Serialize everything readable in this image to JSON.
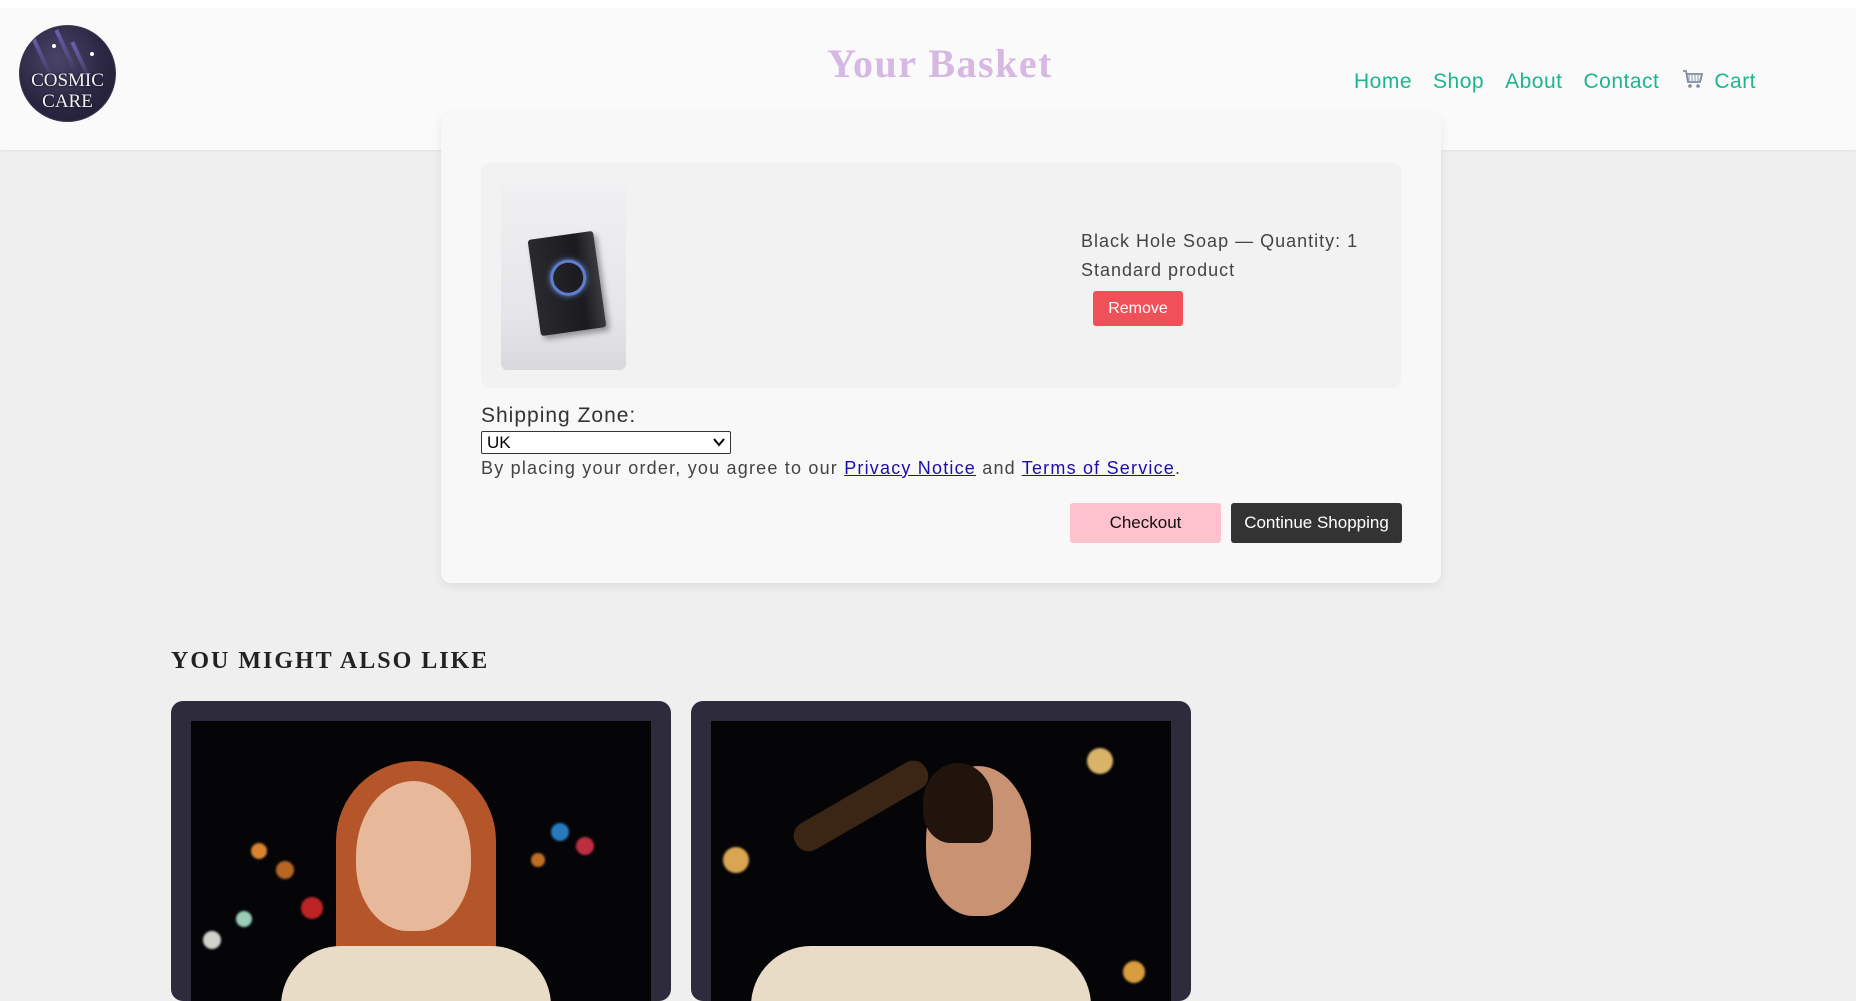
{
  "brand": {
    "logo_line1": "COSMIC",
    "logo_line2": "CARE"
  },
  "page_title": "Your Basket",
  "nav": {
    "items": [
      "Home",
      "Shop",
      "About",
      "Contact"
    ],
    "cart_label": "Cart",
    "cart_icon": "shopping-cart-icon",
    "link_color": "#1db58f"
  },
  "basket": {
    "item": {
      "name_qty": "Black Hole Soap — Quantity: 1",
      "type": "Standard product",
      "remove_label": "Remove",
      "image_icon": "black-hole-soap-image"
    },
    "shipping_label": "Shipping Zone:",
    "shipping_value": "UK",
    "agree_prefix": "By placing your order, you agree to our",
    "privacy_link": "Privacy Notice",
    "agree_and": "and",
    "terms_link": "Terms of Service",
    "agree_suffix": ".",
    "checkout_label": "Checkout",
    "continue_label": "Continue Shopping"
  },
  "recommendations": {
    "title": "YOU MIGHT ALSO LIKE"
  },
  "colors": {
    "title": "#d6b8e2",
    "remove": "#f05158",
    "checkout": "#ffc1cb",
    "continue": "#333333",
    "card_dark": "#2d2b3c"
  }
}
